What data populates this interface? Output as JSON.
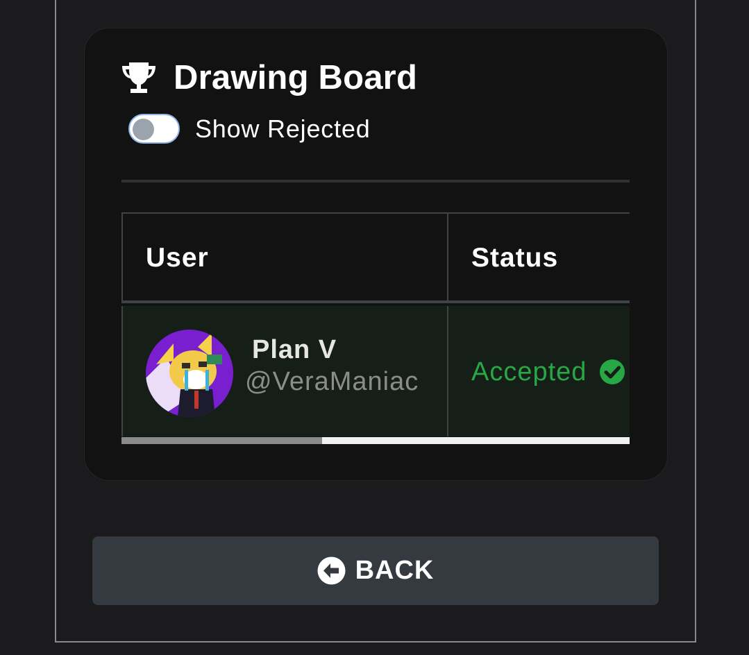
{
  "board": {
    "title": "Drawing Board",
    "icon": "trophy-icon"
  },
  "filter": {
    "show_rejected_label": "Show Rejected",
    "show_rejected_enabled": false
  },
  "table": {
    "columns": [
      "User",
      "Status"
    ],
    "rows": [
      {
        "display_name": "Plan V",
        "handle": "@VeraManiac",
        "status": "Accepted",
        "status_icon": "check-circle-icon"
      }
    ]
  },
  "back_button": {
    "label": "BACK",
    "icon": "arrow-circle-left-icon"
  },
  "colors": {
    "accepted": "#28a745",
    "button_bg": "#343a40",
    "card_bg": "#121212",
    "row_bg": "#161e18"
  }
}
